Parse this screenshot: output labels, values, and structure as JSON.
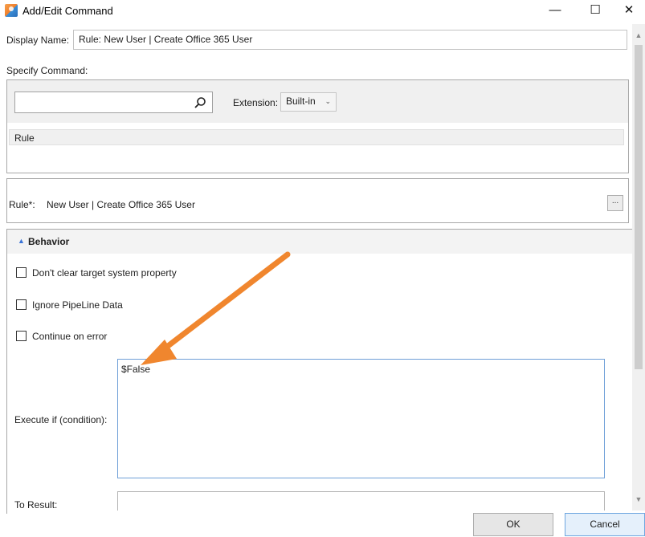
{
  "window": {
    "title": "Add/Edit Command",
    "minimize": "—",
    "maximize": "☐",
    "close": "✕"
  },
  "form": {
    "display_name_label": "Display Name:",
    "display_name_value": "Rule: New User | Create Office 365 User",
    "specify_command_label": "Specify Command:",
    "search_value": "",
    "extension_label": "Extension:",
    "extension_value": "Built-in",
    "command_list": [
      "Rule"
    ],
    "rule_label": "Rule*:",
    "rule_value": "New User | Create Office 365 User",
    "rule_browse": "..."
  },
  "behavior": {
    "title": "Behavior",
    "checkboxes": [
      {
        "label": "Don't clear target system property",
        "checked": false
      },
      {
        "label": "Ignore PipeLine Data",
        "checked": false
      },
      {
        "label": "Continue on error",
        "checked": false
      }
    ],
    "execute_if_label": "Execute if (condition):",
    "execute_if_value": "$False",
    "to_result_label": "To Result:",
    "to_result_value": ""
  },
  "buttons": {
    "ok": "OK",
    "cancel": "Cancel"
  },
  "colors": {
    "annotation_arrow": "#f0862e",
    "accent": "#3b74d8"
  }
}
